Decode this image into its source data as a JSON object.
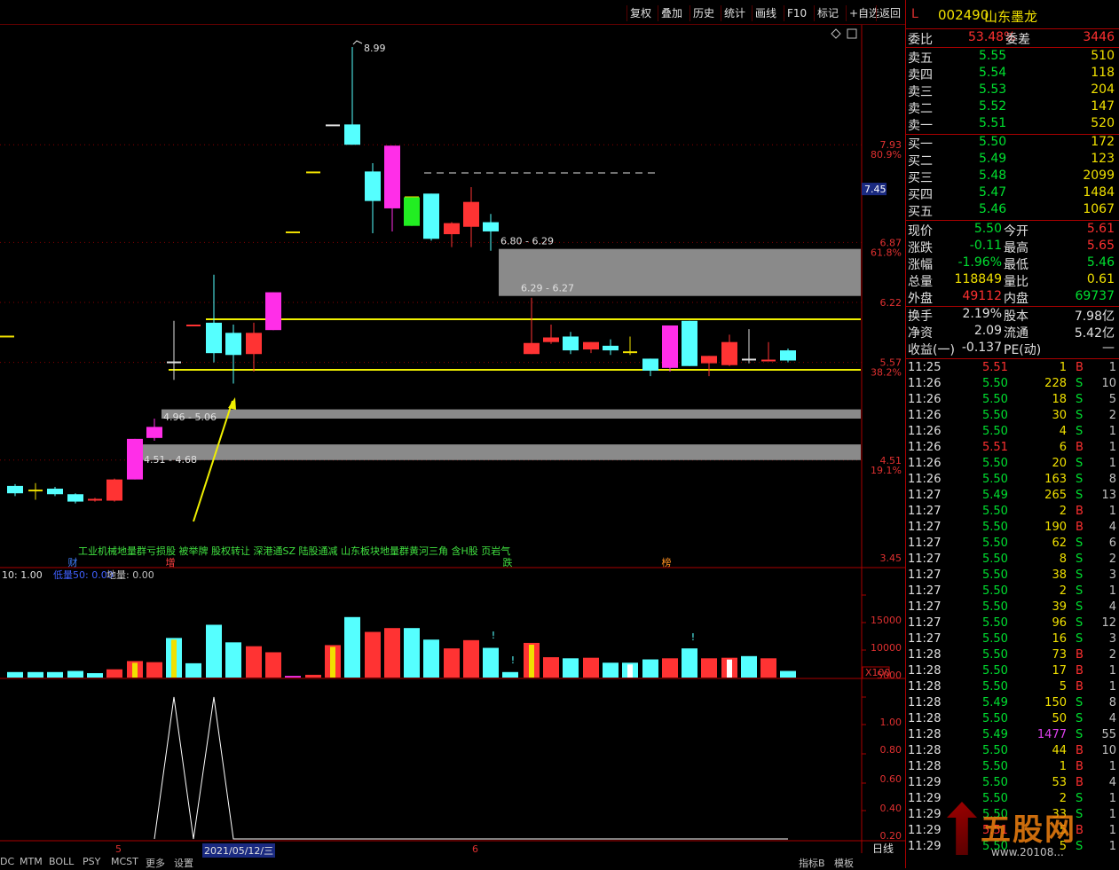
{
  "toolbar": {
    "buttons": [
      "复权",
      "叠加",
      "历史",
      "统计",
      "画线",
      "F10",
      "标记",
      "+自选",
      "返回"
    ]
  },
  "stock": {
    "flag": "L",
    "code": "002490",
    "name": "山东墨龙"
  },
  "order_book": {
    "wei_bi_label": "委比",
    "wei_bi": "53.48%",
    "wei_cha_label": "委差",
    "wei_cha": "3446",
    "asks": [
      {
        "label": "卖五",
        "price": "5.55",
        "vol": "510"
      },
      {
        "label": "卖四",
        "price": "5.54",
        "vol": "118"
      },
      {
        "label": "卖三",
        "price": "5.53",
        "vol": "204"
      },
      {
        "label": "卖二",
        "price": "5.52",
        "vol": "147"
      },
      {
        "label": "卖一",
        "price": "5.51",
        "vol": "520"
      }
    ],
    "bids": [
      {
        "label": "买一",
        "price": "5.50",
        "vol": "172"
      },
      {
        "label": "买二",
        "price": "5.49",
        "vol": "123"
      },
      {
        "label": "买三",
        "price": "5.48",
        "vol": "2099"
      },
      {
        "label": "买四",
        "price": "5.47",
        "vol": "1484"
      },
      {
        "label": "买五",
        "price": "5.46",
        "vol": "1067"
      }
    ]
  },
  "stats": [
    {
      "l1": "现价",
      "v1": "5.50",
      "l2": "今开",
      "v2": "5.61"
    },
    {
      "l1": "涨跌",
      "v1": "-0.11",
      "l2": "最高",
      "v2": "5.65"
    },
    {
      "l1": "涨幅",
      "v1": "-1.96%",
      "l2": "最低",
      "v2": "5.46"
    },
    {
      "l1": "总量",
      "v1": "118849",
      "l2": "量比",
      "v2": "0.61"
    },
    {
      "l1": "外盘",
      "v1": "49112",
      "l2": "内盘",
      "v2": "69737"
    }
  ],
  "stats2": [
    {
      "l1": "换手",
      "v1": "2.19%",
      "l2": "股本",
      "v2": "7.98亿"
    },
    {
      "l1": "净资",
      "v1": "2.09",
      "l2": "流通",
      "v2": "5.42亿"
    },
    {
      "l1": "收益(一)",
      "v1": "-0.137",
      "l2": "PE(动)",
      "v2": "—"
    }
  ],
  "ticks": [
    {
      "t": "11:25",
      "p": "5.51",
      "v": "1",
      "s": "B",
      "n": "1"
    },
    {
      "t": "11:26",
      "p": "5.50",
      "v": "228",
      "s": "S",
      "n": "10"
    },
    {
      "t": "11:26",
      "p": "5.50",
      "v": "18",
      "s": "S",
      "n": "5"
    },
    {
      "t": "11:26",
      "p": "5.50",
      "v": "30",
      "s": "S",
      "n": "2"
    },
    {
      "t": "11:26",
      "p": "5.50",
      "v": "4",
      "s": "S",
      "n": "1"
    },
    {
      "t": "11:26",
      "p": "5.51",
      "v": "6",
      "s": "B",
      "n": "1"
    },
    {
      "t": "11:26",
      "p": "5.50",
      "v": "20",
      "s": "S",
      "n": "1"
    },
    {
      "t": "11:26",
      "p": "5.50",
      "v": "163",
      "s": "S",
      "n": "8"
    },
    {
      "t": "11:27",
      "p": "5.49",
      "v": "265",
      "s": "S",
      "n": "13"
    },
    {
      "t": "11:27",
      "p": "5.50",
      "v": "2",
      "s": "B",
      "n": "1"
    },
    {
      "t": "11:27",
      "p": "5.50",
      "v": "190",
      "s": "B",
      "n": "4"
    },
    {
      "t": "11:27",
      "p": "5.50",
      "v": "62",
      "s": "S",
      "n": "6"
    },
    {
      "t": "11:27",
      "p": "5.50",
      "v": "8",
      "s": "S",
      "n": "2"
    },
    {
      "t": "11:27",
      "p": "5.50",
      "v": "38",
      "s": "S",
      "n": "3"
    },
    {
      "t": "11:27",
      "p": "5.50",
      "v": "2",
      "s": "S",
      "n": "1"
    },
    {
      "t": "11:27",
      "p": "5.50",
      "v": "39",
      "s": "S",
      "n": "4"
    },
    {
      "t": "11:27",
      "p": "5.50",
      "v": "96",
      "s": "S",
      "n": "12"
    },
    {
      "t": "11:27",
      "p": "5.50",
      "v": "16",
      "s": "S",
      "n": "3"
    },
    {
      "t": "11:28",
      "p": "5.50",
      "v": "73",
      "s": "B",
      "n": "2"
    },
    {
      "t": "11:28",
      "p": "5.50",
      "v": "17",
      "s": "B",
      "n": "1"
    },
    {
      "t": "11:28",
      "p": "5.50",
      "v": "5",
      "s": "B",
      "n": "1"
    },
    {
      "t": "11:28",
      "p": "5.49",
      "v": "150",
      "s": "S",
      "n": "8"
    },
    {
      "t": "11:28",
      "p": "5.50",
      "v": "50",
      "s": "S",
      "n": "4"
    },
    {
      "t": "11:28",
      "p": "5.49",
      "v": "1477",
      "s": "S",
      "n": "55"
    },
    {
      "t": "11:28",
      "p": "5.50",
      "v": "44",
      "s": "B",
      "n": "10"
    },
    {
      "t": "11:28",
      "p": "5.50",
      "v": "1",
      "s": "B",
      "n": "1"
    },
    {
      "t": "11:29",
      "p": "5.50",
      "v": "53",
      "s": "B",
      "n": "4"
    },
    {
      "t": "11:29",
      "p": "5.50",
      "v": "2",
      "s": "S",
      "n": "1"
    },
    {
      "t": "11:29",
      "p": "5.50",
      "v": "33",
      "s": "S",
      "n": "1"
    },
    {
      "t": "11:29",
      "p": "5.51",
      "v": "5",
      "s": "B",
      "n": "1"
    },
    {
      "t": "11:29",
      "p": "5.50",
      "v": "5",
      "s": "S",
      "n": "1"
    },
    {
      "t": "11:29",
      "p": "5.50",
      "v": "5",
      "s": "S",
      "n": "1"
    }
  ],
  "price_axis": [
    {
      "v": "7.93",
      "pct": "80.9%"
    },
    {
      "v": "6.87",
      "pct": "61.8%"
    },
    {
      "v": "6.22",
      "pct": ""
    },
    {
      "v": "5.57",
      "pct": "38.2%"
    },
    {
      "v": "4.51",
      "pct": "19.1%"
    },
    {
      "v": "3.45",
      "pct": ""
    }
  ],
  "current_price_tag": "7.45",
  "high_label": "8.99",
  "zones": [
    {
      "label": "6.80 - 6.29"
    },
    {
      "label": "6.29 - 6.27"
    },
    {
      "label": "4.96 - 5.06"
    },
    {
      "label": "4.51 - 4.68"
    }
  ],
  "news_text": "工业机械地量群亏损股 被举牌 股权转让 深港通SZ 陆股通减 山东板块地量群黄河三角 含H股 页岩气",
  "markers": [
    "财",
    "增",
    "跌",
    "榜"
  ],
  "indicator_header": {
    "a": "10: 1.00",
    "b": "低量50: 0.00",
    "c": "地量: 0.00"
  },
  "vol_axis": [
    "15000",
    "10000",
    "5000",
    "X100"
  ],
  "osc_axis": [
    "1.00",
    "0.80",
    "0.60",
    "0.40",
    "0.20"
  ],
  "bottom": {
    "tabs": [
      "DC",
      "MTM",
      "BOLL",
      "PSY",
      "MCST",
      "更多",
      "设置"
    ],
    "date": "2021/05/12/三",
    "month5": "5",
    "month6": "6",
    "period": "日线",
    "right_tabs": [
      "指标B",
      "模板"
    ]
  },
  "watermark": {
    "brand": "五股网",
    "url": "www.20108..."
  },
  "colors": {
    "up": "#ff3333",
    "down": "#55ffff",
    "bg": "#000000",
    "accent": "#f0e000",
    "pink": "#ff2ee8"
  }
}
